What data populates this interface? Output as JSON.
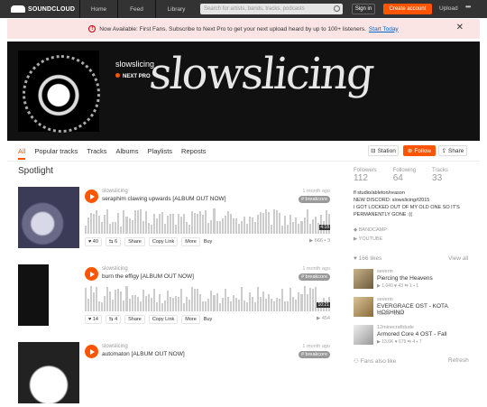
{
  "header": {
    "logo": "SOUNDCLOUD",
    "nav": [
      "Home",
      "Feed",
      "Library"
    ],
    "search_placeholder": "Search for artists, bands, tracks, podcasts",
    "sign_in": "Sign in",
    "create_account": "Create account",
    "upload": "Upload",
    "more": "•••"
  },
  "banner": {
    "text": "Now Available: First Fans. Subscribe to Next Pro to get your next upload heard by up to 100+ listeners.",
    "link": "Start Today"
  },
  "profile": {
    "username": "slowslicing",
    "badge": "NEXT PRO",
    "artwork_text": "slowslicing"
  },
  "tabs": [
    "All",
    "Popular tracks",
    "Tracks",
    "Albums",
    "Playlists",
    "Reposts"
  ],
  "profile_actions": {
    "station": "Station",
    "follow": "Follow",
    "share": "Share"
  },
  "section_title": "Spotlight",
  "tracks": [
    {
      "artist": "slowslicing",
      "title": "seraphim clawing upwards [ALBUM OUT NOW]",
      "when": "1 month ago",
      "tag": "# breakcore",
      "duration": "4:18",
      "likes": "40",
      "reposts": "6",
      "plays": "666",
      "comments": "3"
    },
    {
      "artist": "slowslicing",
      "title": "burn the effigy [ALBUM OUT NOW]",
      "when": "1 month ago",
      "tag": "# breakcore",
      "duration": "10:21",
      "likes": "14",
      "reposts": "4",
      "plays": "454",
      "comments": ""
    },
    {
      "artist": "slowslicing",
      "title": "automaton [ALBUM OUT NOW]",
      "when": "1 month ago",
      "tag": "# breakcore",
      "duration": "",
      "likes": "",
      "reposts": "",
      "plays": "",
      "comments": ""
    }
  ],
  "track_actions": {
    "share": "Share",
    "copy": "Copy Link",
    "more": "More",
    "buy": "Buy"
  },
  "stats": [
    {
      "label": "Followers",
      "value": "112"
    },
    {
      "label": "Following",
      "value": "64"
    },
    {
      "label": "Tracks",
      "value": "33"
    }
  ],
  "bio": [
    "fl studio/ableton/reason",
    "NEW DISCORD: slowslicing#2015",
    "I GOT LOCKED OUT OF MY OLD ONE SO IT'S",
    "PERMANENTLY GONE :(("
  ],
  "links": [
    "BANDCAMP",
    "YOUTUBE"
  ],
  "likes_header": "166 likes",
  "view_all": "View all",
  "likes": [
    {
      "artist": "severin",
      "title": "Piercing the Heavens",
      "stats": "▶ 1,640  ♥ 43  ⇆ 1  ▪ 1"
    },
    {
      "artist": "severin",
      "title": "EVERGRACE OST - KOTA HOSHINO",
      "stats": "Album · 2020"
    },
    {
      "artist": "12minecraftdude",
      "title": "Armored Core 4 OST - Fall",
      "stats": "▶ 13.6K  ♥ 679  ⇆ 4  ▪ 7"
    }
  ],
  "fans_header": "Fans also like",
  "refresh": "Refresh",
  "colors": {
    "accent": "#ff5500",
    "topbar": "#333333"
  }
}
